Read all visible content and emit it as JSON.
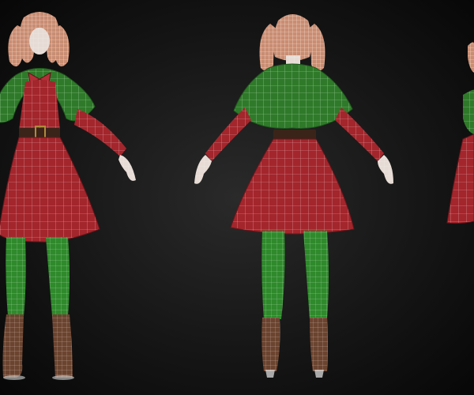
{
  "scene": {
    "description_hidden": "",
    "views": [
      {
        "id": "front",
        "label": ""
      },
      {
        "id": "back",
        "label": ""
      },
      {
        "id": "side",
        "label": ""
      }
    ],
    "colors": {
      "background_center": "#2a2a2a",
      "background_edge": "#070707",
      "dress_red": "#a3262c",
      "dress_red_dark": "#7a1a20",
      "cape_green": "#2f7a2a",
      "cape_green_dark": "#1f5a1c",
      "tights_green": "#2f8a2c",
      "boots_brown": "#6b4430",
      "hair_wire": "#d8a38a",
      "skin": "#e8dcd6",
      "wire_white": "#ffffff"
    }
  }
}
